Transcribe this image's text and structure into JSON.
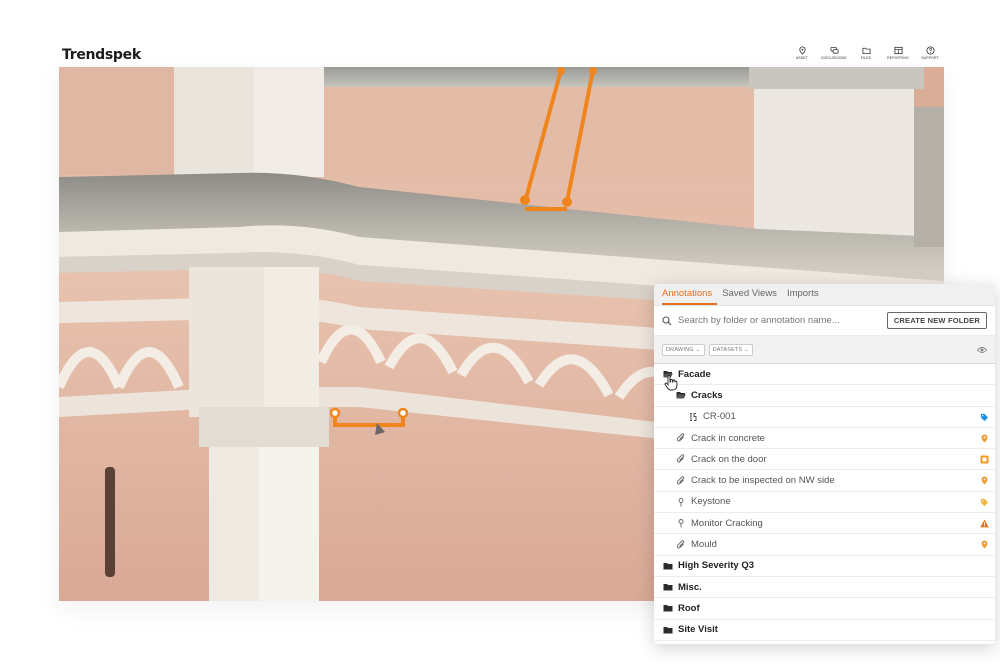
{
  "app": {
    "logo_text": "Trendspek"
  },
  "nav": [
    {
      "label": "ASSET",
      "icon": "map-pin-icon"
    },
    {
      "label": "DISCUSSIONS",
      "icon": "chat-icon"
    },
    {
      "label": "FILES",
      "icon": "folder-icon"
    },
    {
      "label": "REPORTING",
      "icon": "report-icon"
    },
    {
      "label": "SUPPORT",
      "icon": "help-icon"
    }
  ],
  "panel": {
    "tabs": [
      {
        "label": "Annotations",
        "active": true
      },
      {
        "label": "Saved Views",
        "active": false
      },
      {
        "label": "Imports",
        "active": false
      }
    ],
    "search": {
      "placeholder": "Search by folder or annotation name..."
    },
    "create_folder_label": "CREATE NEW FOLDER",
    "filters": {
      "drawing": "DRAWING",
      "datasets": "DATASETS"
    },
    "tree": [
      {
        "type": "folder",
        "level": 0,
        "label": "Facade",
        "open": true
      },
      {
        "type": "folder",
        "level": 1,
        "label": "Cracks",
        "open": true
      },
      {
        "type": "item",
        "level": 2,
        "label": "CR-001",
        "icon": "bracket-icon",
        "badge": "tag",
        "badge_color": "#1e90e8"
      },
      {
        "type": "item",
        "level": 1,
        "label": "Crack in concrete",
        "icon": "paperclip-icon",
        "badge": "pin",
        "badge_color": "#f29b2b"
      },
      {
        "type": "item",
        "level": 1,
        "label": "Crack on the door",
        "icon": "paperclip-icon",
        "badge": "square",
        "badge_color": "#f29b2b"
      },
      {
        "type": "item",
        "level": 1,
        "label": "Crack to be inspected on NW side",
        "icon": "paperclip-icon",
        "badge": "pin",
        "badge_color": "#f29b2b"
      },
      {
        "type": "item",
        "level": 1,
        "label": "Keystone",
        "icon": "pin-outline-icon",
        "badge": "tag",
        "badge_color": "#f2b43c"
      },
      {
        "type": "item",
        "level": 1,
        "label": "Monitor Cracking",
        "icon": "pin-outline-icon",
        "badge": "warning",
        "badge_color": "#e0711f"
      },
      {
        "type": "item",
        "level": 1,
        "label": "Mould",
        "icon": "paperclip-icon",
        "badge": "pin",
        "badge_color": "#f29b2b"
      },
      {
        "type": "folder",
        "level": 0,
        "label": "High Severity Q3",
        "open": false
      },
      {
        "type": "folder",
        "level": 0,
        "label": "Misc.",
        "open": false
      },
      {
        "type": "folder",
        "level": 0,
        "label": "Roof",
        "open": false
      },
      {
        "type": "folder",
        "level": 0,
        "label": "Site Visit",
        "open": false
      }
    ]
  },
  "colors": {
    "accent": "#e0711f",
    "annotation": "#f0851e"
  }
}
